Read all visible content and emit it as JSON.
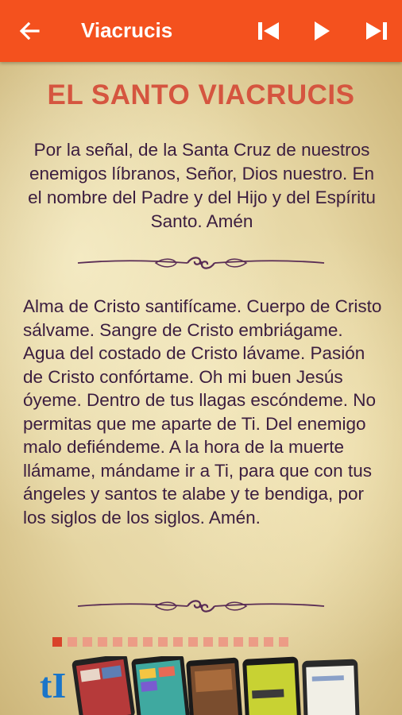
{
  "appbar": {
    "title": "Viacrucis",
    "back_icon": "arrow-left-icon",
    "controls": [
      "skip-previous-icon",
      "play-icon",
      "skip-next-icon"
    ],
    "background": "#f4511e"
  },
  "content": {
    "heading": "EL SANTO VIACRUCIS",
    "heading_color": "#d5553f",
    "intro": "Por la señal, de la Santa Cruz de nuestros enemigos líbranos, Señor, Dios nuestro. En el nombre del Padre y del Hijo y del Espíritu Santo. Amén",
    "prayer": "Alma de Cristo santifícame. Cuerpo de Cristo sálvame. Sangre de Cristo embriágame. Agua del costado de Cristo lávame. Pasión de Cristo confórtame. Oh mi buen Jesús óyeme. Dentro de tus llagas escóndeme. No permitas que me aparte de Ti. Del enemigo malo defiéndeme. A la hora de la muerte llámame, mándame ir a Ti, para que con tus ángeles y santos te alabe y te bendiga, por los siglos de los siglos. Amén.",
    "text_color": "#3b1d3f"
  },
  "pager": {
    "total": 16,
    "current": 1,
    "active_color": "#d9432a",
    "inactive_color": "#ec9c86"
  },
  "banner": {
    "logo_text": "tI",
    "logo_icon": "tl-logo-icon"
  }
}
